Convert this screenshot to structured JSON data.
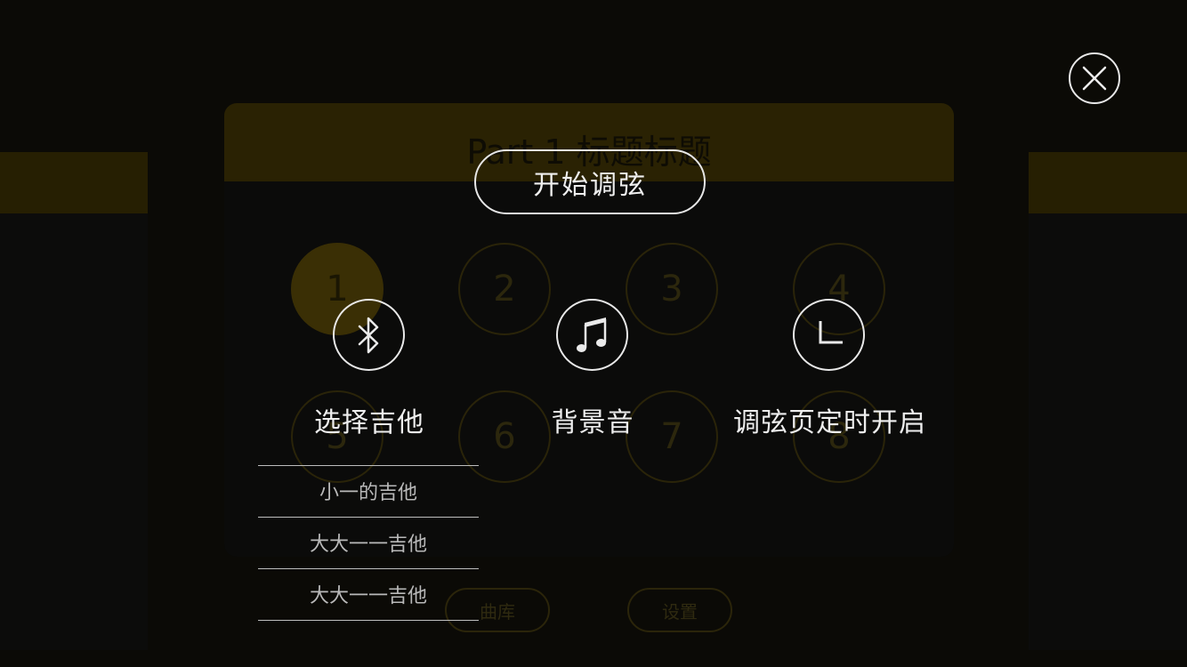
{
  "background": {
    "card_title": "Part 1 标题标题",
    "numbers": [
      "1",
      "2",
      "3",
      "4",
      "5",
      "6",
      "7",
      "8"
    ],
    "active_number": "1",
    "bottom_buttons": [
      "曲库",
      "设置"
    ]
  },
  "overlay": {
    "close_icon": "close-icon",
    "start_tuning_label": "开始调弦",
    "options": [
      {
        "icon": "bluetooth-icon",
        "label": "选择吉他"
      },
      {
        "icon": "music-note-icon",
        "label": "背景音"
      },
      {
        "icon": "clock-icon",
        "label": "调弦页定时开启"
      }
    ],
    "guitar_list": [
      "小一的吉他",
      "大大一一吉他",
      "大大一一吉他"
    ]
  },
  "colors": {
    "accent_dim": "#3a2f05",
    "overlay_text": "#eeeeee",
    "background": "#050505"
  }
}
